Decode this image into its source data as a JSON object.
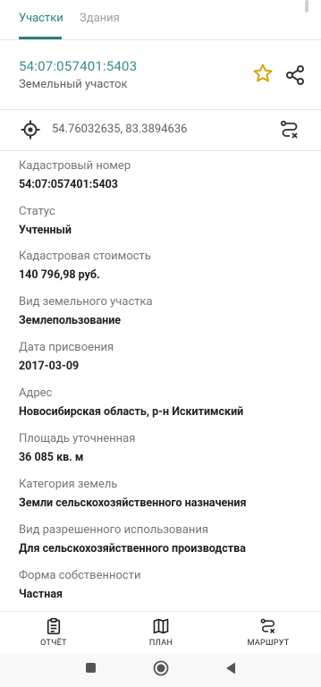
{
  "tabs": [
    {
      "label": "Участки",
      "active": true
    },
    {
      "label": "Здания",
      "active": false
    }
  ],
  "parcel": {
    "cadastral_number": "54:07:057401:5403",
    "type": "Земельный участок"
  },
  "icons": {
    "favorite": "star-icon",
    "share": "share-icon",
    "location": "crosshair-target-icon",
    "route": "route-icon"
  },
  "coords": "54.76032635, 83.3894636",
  "fields": [
    {
      "label": "Кадастровый номер",
      "value": "54:07:057401:5403"
    },
    {
      "label": "Статус",
      "value": "Учтенный"
    },
    {
      "label": "Кадастровая стоимость",
      "value": "140 796,98 руб."
    },
    {
      "label": "Вид земельного участка",
      "value": "Землепользование"
    },
    {
      "label": "Дата присвоения",
      "value": "2017-03-09"
    },
    {
      "label": "Адрес",
      "value": "Новосибирская область, р-н Искитимский"
    },
    {
      "label": "Площадь уточненная",
      "value": "36 085 кв. м"
    },
    {
      "label": "Категория земель",
      "value": "Земли сельскохозяйственного назначения"
    },
    {
      "label": "Вид разрешенного использования",
      "value": "Для сельскохозяйственного производства"
    },
    {
      "label": "Форма собственности",
      "value": "Частная"
    }
  ],
  "bottom_nav": [
    {
      "label": "ОТЧЁТ",
      "icon": "report-icon"
    },
    {
      "label": "ПЛАН",
      "icon": "map-icon"
    },
    {
      "label": "МАРШРУТ",
      "icon": "route-icon"
    }
  ],
  "colors": {
    "accent": "#2e7d7d",
    "star": "#d9a400",
    "label": "#757575",
    "value": "#212121"
  }
}
